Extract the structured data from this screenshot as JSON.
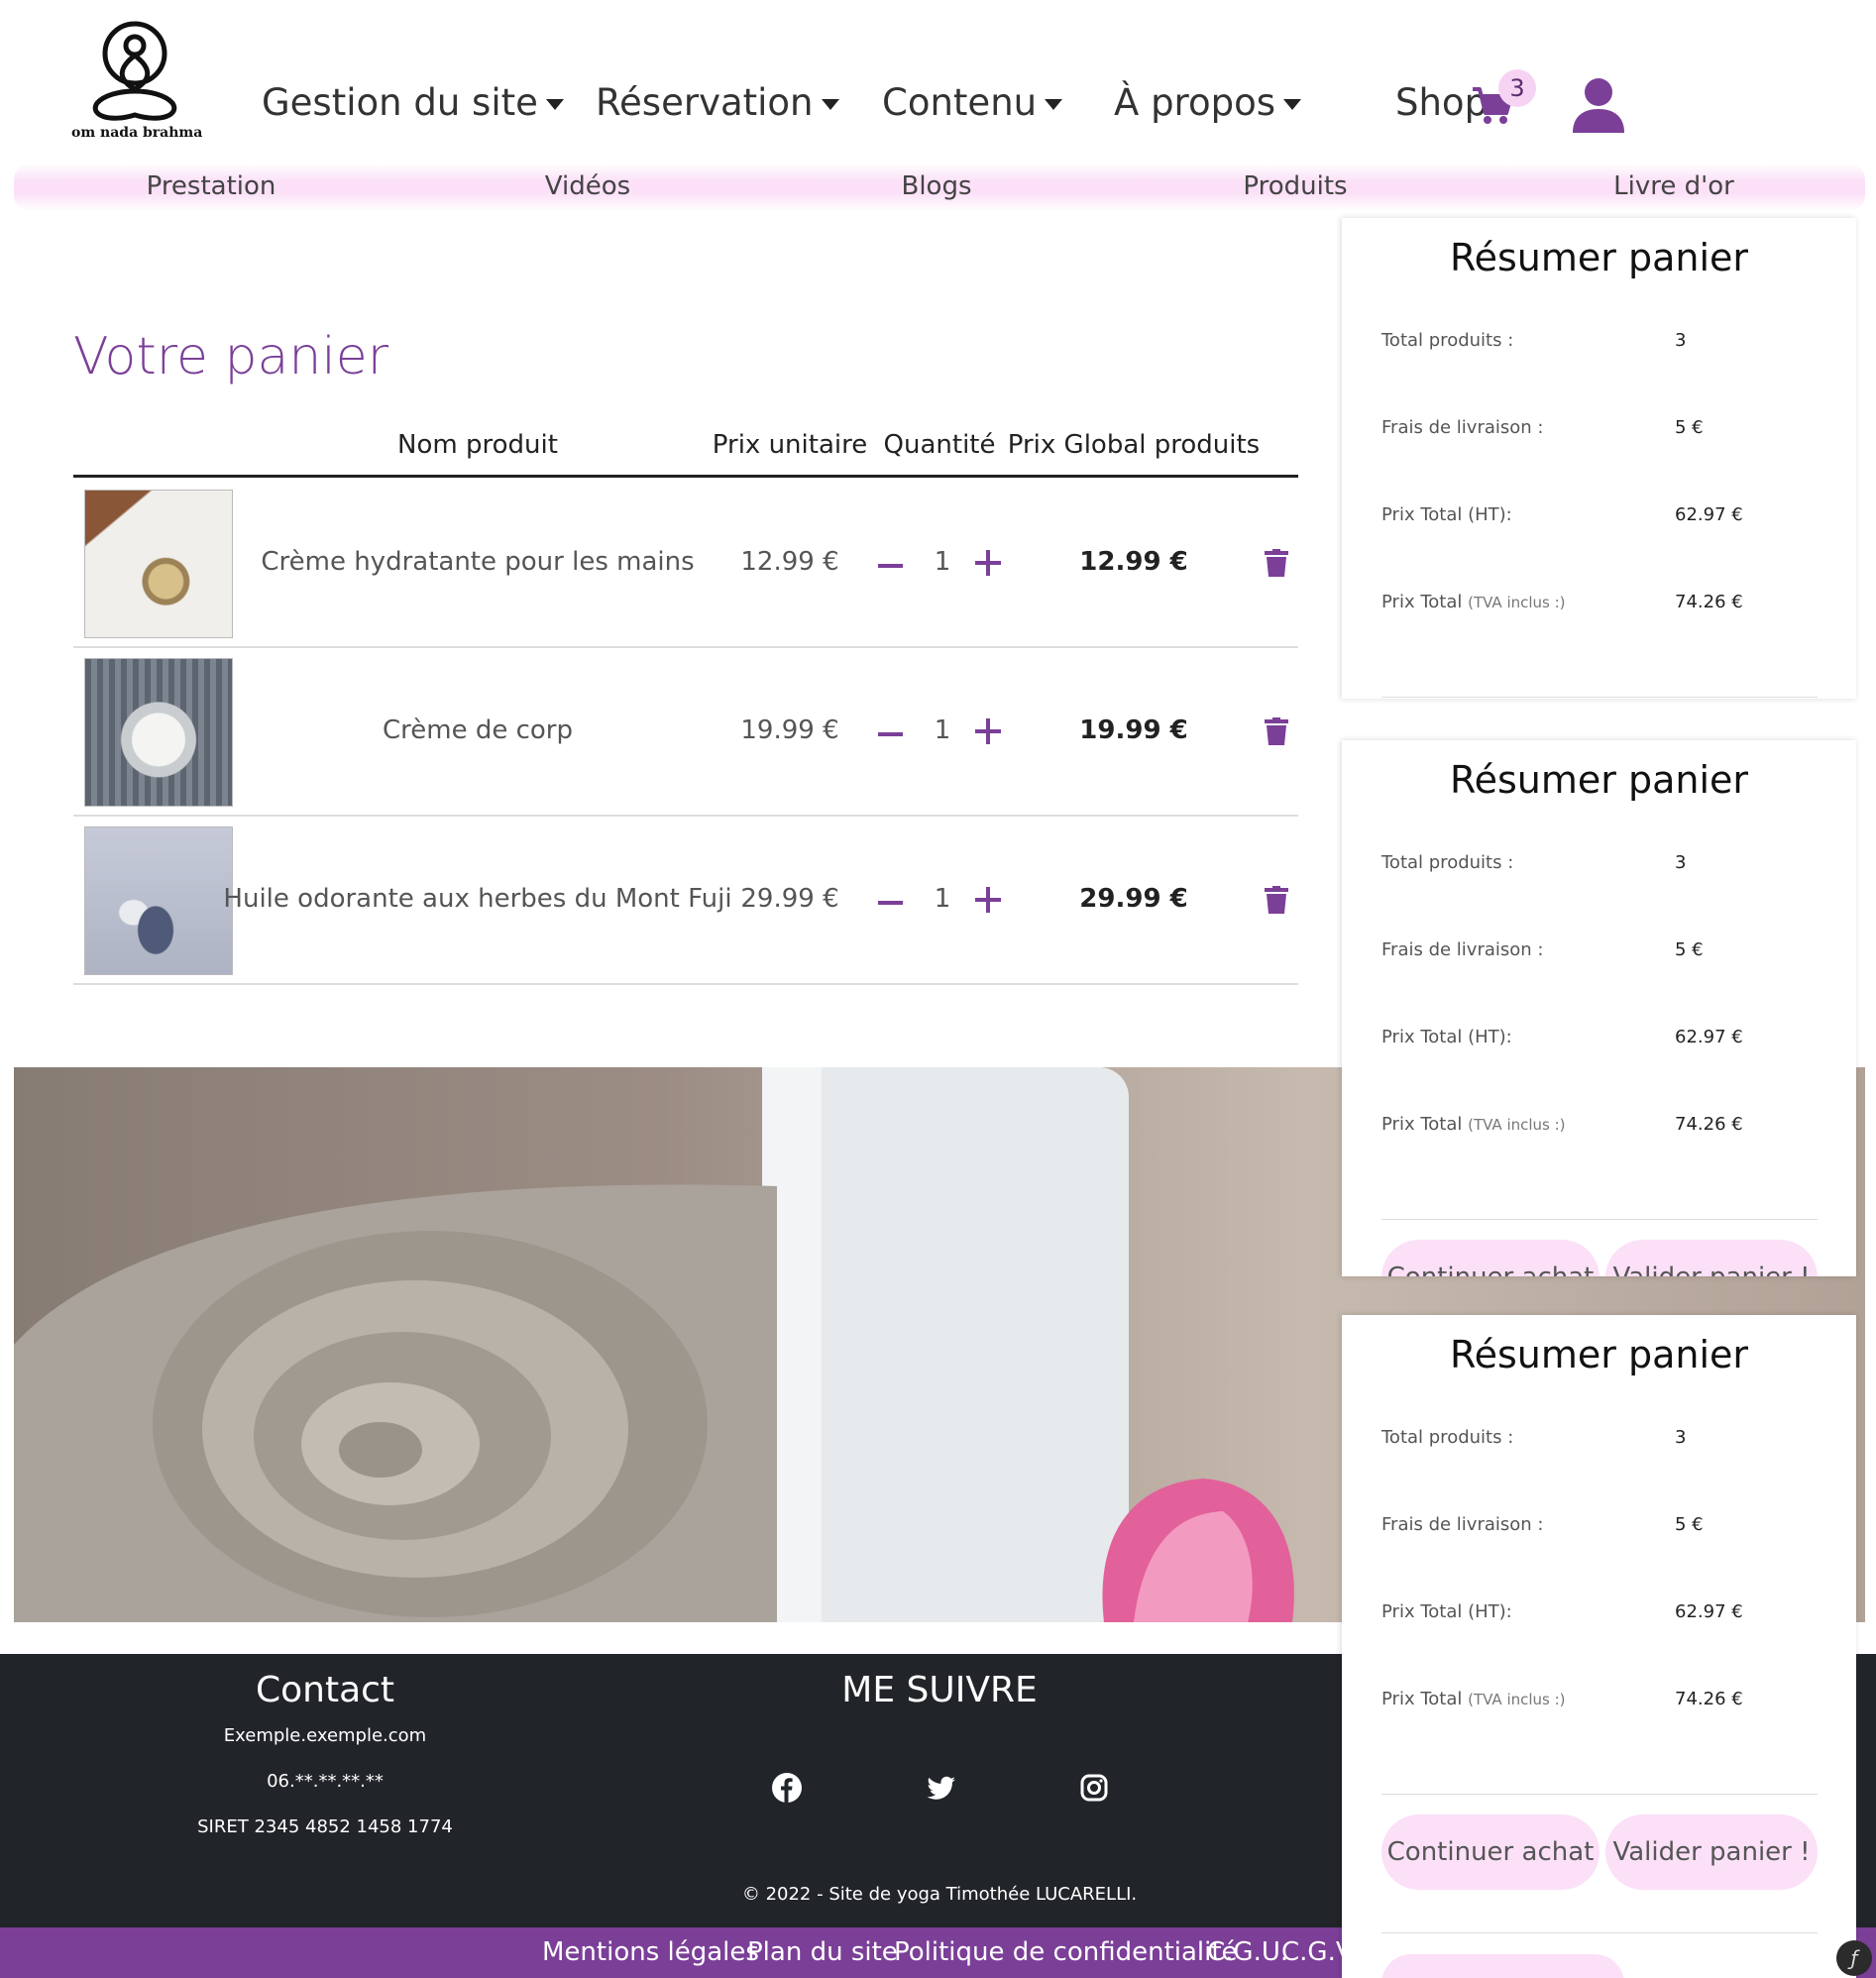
{
  "logo": {
    "text": "om nada brahma"
  },
  "nav": {
    "items": [
      "Gestion du site",
      "Réservation",
      "Contenu",
      "À propos"
    ],
    "shop_label": "Shop",
    "cart_count": "3"
  },
  "subnav": {
    "items": [
      "Prestation",
      "Vidéos",
      "Blogs",
      "Produits",
      "Livre d'or"
    ]
  },
  "cart": {
    "title": "Votre panier",
    "headers": {
      "name": "Nom produit",
      "unit_price": "Prix unitaire",
      "quantity": "Quantité",
      "total": "Prix Global produits"
    },
    "rows": [
      {
        "name": "Crème hydratante pour les mains",
        "unit_price": "12.99 €",
        "quantity": "1",
        "total": "12.99 €"
      },
      {
        "name": "Crème de corp",
        "unit_price": "19.99 €",
        "quantity": "1",
        "total": "19.99 €"
      },
      {
        "name": "Huile odorante aux herbes du Mont Fuji",
        "unit_price": "29.99 €",
        "quantity": "1",
        "total": "29.99 €"
      }
    ]
  },
  "summary": {
    "title": "Résumer panier",
    "total_products_label": "Total produits :",
    "total_products_value": "3",
    "shipping_label": "Frais de livraison :",
    "shipping_value": "5 €",
    "total_ht_label": "Prix Total (HT):",
    "total_ht_value": "62.97 €",
    "total_ttc_label": "Prix Total",
    "total_ttc_note": "(TVA inclus :)",
    "total_ttc_value": "74.26 €",
    "continue_label": "Continuer achat",
    "validate_label": "Valider panier !"
  },
  "footer": {
    "contact_title": "Contact",
    "email": "Exemple.exemple.com",
    "phone": "06.**.**.**.**",
    "siret": "SIRET 2345 4852 1458 1774",
    "follow_title": "ME SUIVRE",
    "copyright": "© 2022 - Site de yoga Timothée LUCARELLI."
  },
  "legal": {
    "links": [
      "Mentions légales",
      "Plan du site",
      "Politique de confidentialité",
      "C.G.U.",
      "C.G.V."
    ]
  },
  "colors": {
    "accent": "#7b3f98",
    "pink": "#fbe0f7",
    "footer_bg": "#212529"
  }
}
